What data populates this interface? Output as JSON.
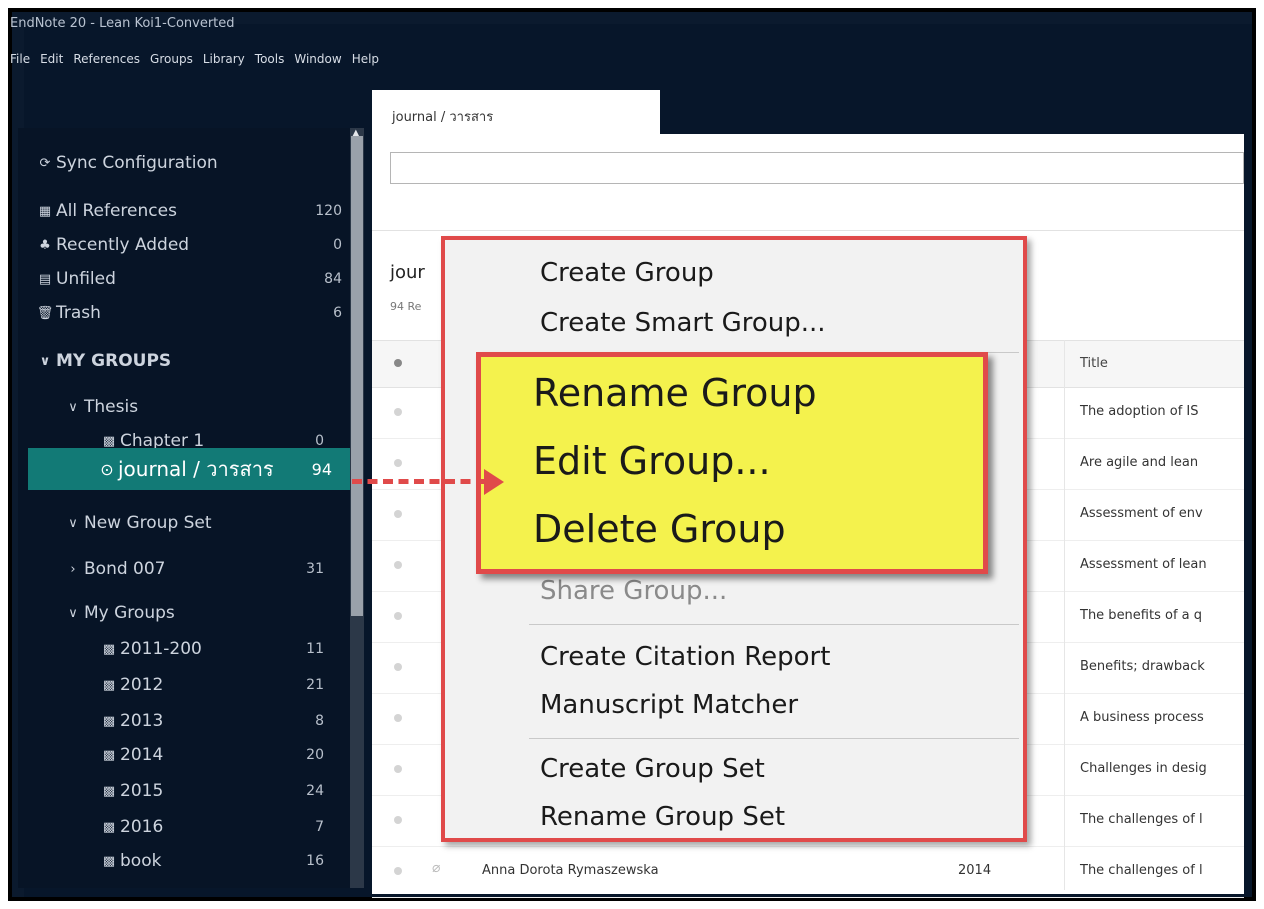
{
  "window": {
    "title": "EndNote 20 - Lean Koi1-Converted"
  },
  "menubar": [
    "File",
    "Edit",
    "References",
    "Groups",
    "Library",
    "Tools",
    "Window",
    "Help"
  ],
  "sidebar": {
    "sync": "Sync Configuration",
    "items": [
      {
        "label": "All References",
        "count": "120",
        "icon": "library-icon"
      },
      {
        "label": "Recently Added",
        "count": "0",
        "icon": "clock-icon"
      },
      {
        "label": "Unfiled",
        "count": "84",
        "icon": "unfiled-icon"
      },
      {
        "label": "Trash",
        "count": "6",
        "icon": "trash-icon"
      }
    ],
    "my_groups_header": "MY GROUPS",
    "thesis": "Thesis",
    "chapter": {
      "label": "Chapter 1",
      "count": "0"
    },
    "journal": {
      "label": "journal / วารสาร",
      "count": "94"
    },
    "new_group_set": "New Group Set",
    "bond": {
      "label": "Bond 007",
      "count": "31"
    },
    "my_groups_sub": "My Groups",
    "years": [
      {
        "label": "2011-200",
        "count": "11"
      },
      {
        "label": "2012",
        "count": "21"
      },
      {
        "label": "2013",
        "count": "8"
      },
      {
        "label": "2014",
        "count": "20"
      },
      {
        "label": "2015",
        "count": "24"
      },
      {
        "label": "2016",
        "count": "7"
      },
      {
        "label": "book",
        "count": "16"
      }
    ]
  },
  "tab": {
    "label": "journal / วารสาร"
  },
  "group_header": {
    "title": "jour",
    "count": "94 Re"
  },
  "table": {
    "title_header": "Title",
    "rows": [
      {
        "title": "The adoption of IS"
      },
      {
        "title": "Are agile and lean"
      },
      {
        "title": "Assessment of env"
      },
      {
        "title": "Assessment of lean"
      },
      {
        "title": "The benefits of a q"
      },
      {
        "title": "Benefits; drawback"
      },
      {
        "title": "A business process"
      },
      {
        "title": "Challenges in desig"
      },
      {
        "title": "The challenges of l"
      },
      {
        "author": "Anna Dorota Rymaszewska",
        "year": "2014",
        "title": "The challenges of l"
      }
    ]
  },
  "context_menu": {
    "create_group": "Create Group",
    "create_smart_group": "Create Smart Group...",
    "rename_group": "Rename Group",
    "edit_group": "Edit Group...",
    "delete_group": "Delete Group",
    "share_group": "Share Group...",
    "create_citation_report": "Create Citation Report",
    "manuscript_matcher": "Manuscript Matcher",
    "create_group_set": "Create Group Set",
    "rename_group_set": "Rename Group Set"
  },
  "colors": {
    "accent_teal": "#127a76",
    "highlight_yellow": "#f4f24d",
    "annotation_red": "#e04a4a",
    "sidebar_bg": "#071426"
  }
}
